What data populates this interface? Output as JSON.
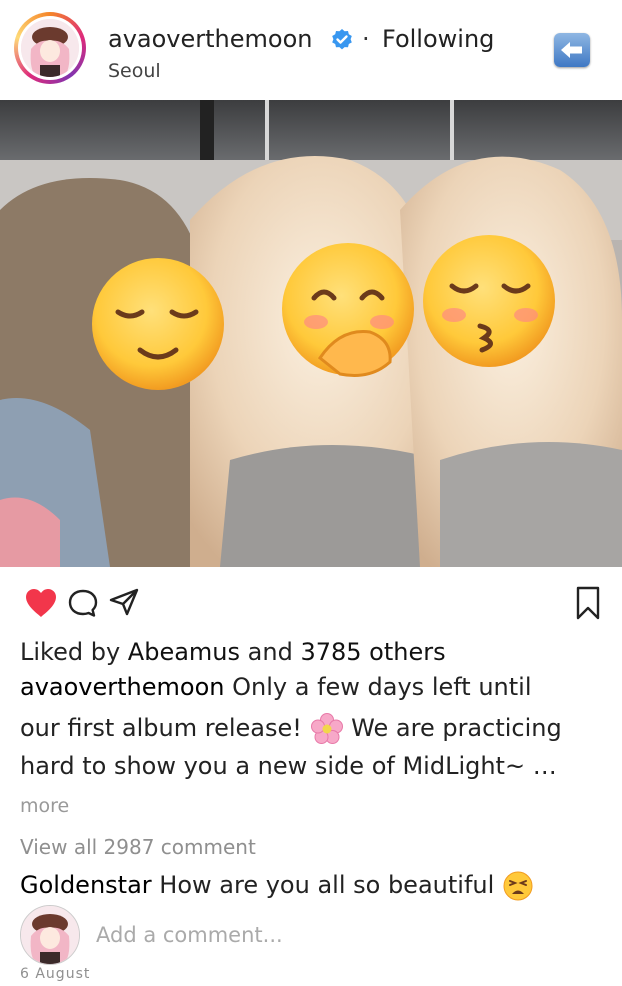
{
  "post": {
    "username": "avaoverthemoon",
    "separator": "·",
    "follow_status": "Following",
    "location": "Seoul",
    "liked_by_prefix": "Liked by",
    "liked_by_user": "Abeamus",
    "liked_by_and": "and",
    "liked_by_others": "3785 others",
    "caption_user": "avaoverthemoon",
    "caption_line1": "Only a few days left until",
    "caption_line2a": "our first album release!",
    "caption_line2b": "We are practicing",
    "caption_line3": "hard to show you a new side of MidLight~ …",
    "more": "more",
    "view_all_comments": "View all 2987 comment",
    "comment_user": "Goldenstar",
    "comment_text": "How are you all so beautiful",
    "add_comment_placeholder": "Add a comment...",
    "date": "6 August"
  },
  "icons": {
    "verified": "verified-badge-icon",
    "back": "back-arrow-icon",
    "heart": "heart-icon",
    "comment": "comment-icon",
    "share": "share-icon",
    "bookmark": "bookmark-icon",
    "flower_emoji": "cherry-blossom-emoji",
    "tired_emoji": "tired-face-emoji"
  },
  "colors": {
    "like_red": "#f2364b",
    "verified_blue": "#3897f0",
    "muted_text": "#8f8f8f"
  }
}
